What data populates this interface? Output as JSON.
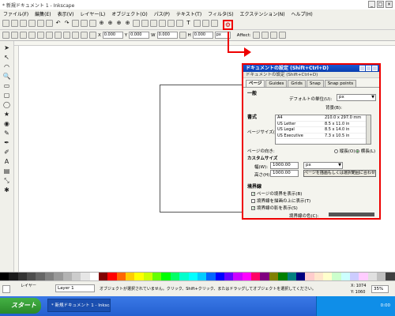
{
  "window": {
    "title": "* 新規ドキュメント 1 - Inkscape",
    "buttons": [
      "_",
      "□",
      "×"
    ]
  },
  "menubar": [
    "ファイル(F)",
    "編集(E)",
    "表示(V)",
    "レイヤー(L)",
    "オブジェクト(O)",
    "パス(P)",
    "テキスト(T)",
    "フィルタ(S)",
    "エクステンション(N)",
    "ヘルプ(H)"
  ],
  "toolbar2": {
    "x_label": "X",
    "x_value": "0.000",
    "y_label": "Y",
    "y_value": "0.000",
    "w_label": "W",
    "w_value": "0.000",
    "h_label": "H",
    "h_value": "0.000",
    "unit": "px",
    "affect_label": "Affect:"
  },
  "tools": [
    "➤",
    "↖",
    "◠",
    "🔍",
    "▭",
    "▢",
    "◯",
    "★",
    "◉",
    "✎",
    "✒",
    "✐",
    "A",
    "▤",
    "⤡",
    "✱"
  ],
  "dialog": {
    "title": "ドキュメントの設定 (Shift+Ctrl+D)",
    "subtitle": "ドキュメントの設定 (Shift+Ctrl+D)",
    "tabs": [
      "ページ",
      "Guides",
      "Grids",
      "Snap",
      "Snap points"
    ],
    "general_section": "一般",
    "default_unit_label": "デフォルトの単位(U):",
    "default_unit_value": "px",
    "background_label": "背景(B):",
    "format_section": "書式",
    "page_size_label": "ページサイズ(Z):",
    "formats": [
      {
        "name": "A4",
        "size": "210.0 x 297.0 mm"
      },
      {
        "name": "US Letter",
        "size": "8.5 x 11.0 in"
      },
      {
        "name": "US Legal",
        "size": "8.5 x 14.0 in"
      },
      {
        "name": "US Executive",
        "size": "7.3 x 10.5 in"
      }
    ],
    "orientation_label": "ページの向き:",
    "portrait_label": "縦長(O)",
    "landscape_label": "横長(L)",
    "custom_size_label": "カスタムサイズ",
    "width_label": "幅(W):",
    "width_value": "1000.00",
    "height_label": "高さ(H):",
    "height_value": "1000.00",
    "custom_unit": "px",
    "fit_button": "ページを描画もしくは選択範囲に合わせる(F)",
    "border_section": "境界線",
    "show_border": "ページの境界を表示(B)",
    "border_on_top": "境界線を描画の上に表示(T)",
    "show_shadow": "境界線の影を表示(S)",
    "border_color_label": "境界線の色(C):"
  },
  "statusbar": {
    "layer_prefix": "レイヤー",
    "layer": "Layer 1",
    "message": "オブジェクトが選択されていません。クリック、Shift+クリック、またはドラッグしてオブジェクトを選択してください。",
    "cursor_x": "X: 1074",
    "cursor_y": "Y: 1060",
    "zoom": "35%"
  },
  "taskbar": {
    "start": "スタート",
    "task": "* 新規ドキュメント 1 - Inkscape",
    "clock": "0:00"
  },
  "palette": [
    "#000000",
    "#1a1a1a",
    "#333333",
    "#4d4d4d",
    "#666666",
    "#808080",
    "#999999",
    "#b3b3b3",
    "#cccccc",
    "#e6e6e6",
    "#ffffff",
    "#800000",
    "#ff0000",
    "#ff6600",
    "#ffcc00",
    "#ffff00",
    "#ccff00",
    "#66ff00",
    "#00ff00",
    "#00ff66",
    "#00ffcc",
    "#00ffff",
    "#00ccff",
    "#0066ff",
    "#0000ff",
    "#6600ff",
    "#cc00ff",
    "#ff00ff",
    "#ff0066",
    "#800080",
    "#808000",
    "#008000",
    "#008080",
    "#000080",
    "#ffcccc",
    "#ffe6cc",
    "#ffffcc",
    "#ccffcc",
    "#ccffff",
    "#ccccff",
    "#ffccff",
    "#e0e0e0",
    "#c0c0c0",
    "#404040"
  ]
}
